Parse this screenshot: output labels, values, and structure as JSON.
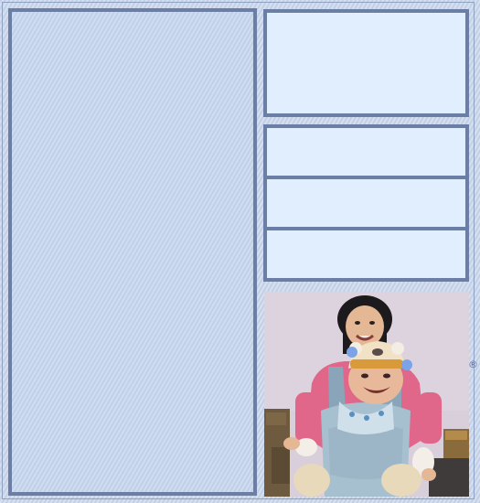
{
  "registered_mark": "®",
  "colors": {
    "panel_border": "#6b7ea6",
    "panel_fill": "#e1eefd",
    "background": "#c9d6ea"
  }
}
